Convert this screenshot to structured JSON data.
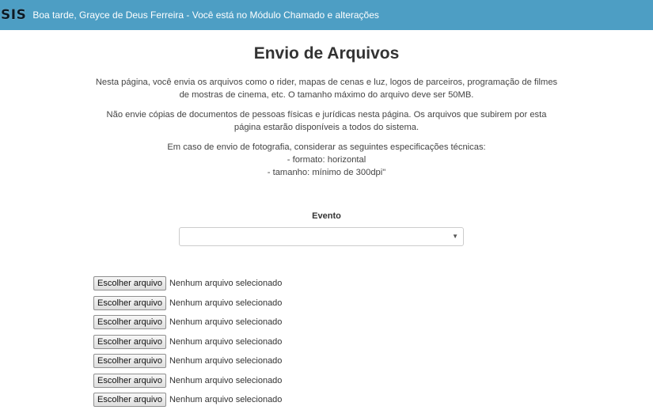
{
  "header": {
    "logo": "SIS",
    "greeting": "Boa tarde, Grayce de Deus Ferreira - Você está no Módulo Chamado e alterações"
  },
  "main": {
    "title": "Envio de Arquivos",
    "paragraphs": [
      "Nesta página, você envia os arquivos como o rider, mapas de cenas e luz, logos de parceiros, programação de filmes de mostras de cinema, etc. O tamanho máximo do arquivo deve ser 50MB.",
      "Não envie cópias de documentos de pessoas físicas e jurídicas nesta página. Os arquivos que subirem por esta página estarão disponíveis a todos do sistema."
    ],
    "specs": {
      "intro": "Em caso de envio de fotografia, considerar as seguintes especificações técnicas:",
      "formato": "- formato: horizontal",
      "tamanho": "- tamanho: mínimo de 300dpi\""
    },
    "evento": {
      "label": "Evento",
      "selected": "",
      "caret": "▼"
    },
    "file_inputs": [
      {
        "button": "Escolher arquivo",
        "status": "Nenhum arquivo selecionado"
      },
      {
        "button": "Escolher arquivo",
        "status": "Nenhum arquivo selecionado"
      },
      {
        "button": "Escolher arquivo",
        "status": "Nenhum arquivo selecionado"
      },
      {
        "button": "Escolher arquivo",
        "status": "Nenhum arquivo selecionado"
      },
      {
        "button": "Escolher arquivo",
        "status": "Nenhum arquivo selecionado"
      },
      {
        "button": "Escolher arquivo",
        "status": "Nenhum arquivo selecionado"
      },
      {
        "button": "Escolher arquivo",
        "status": "Nenhum arquivo selecionado"
      }
    ]
  }
}
